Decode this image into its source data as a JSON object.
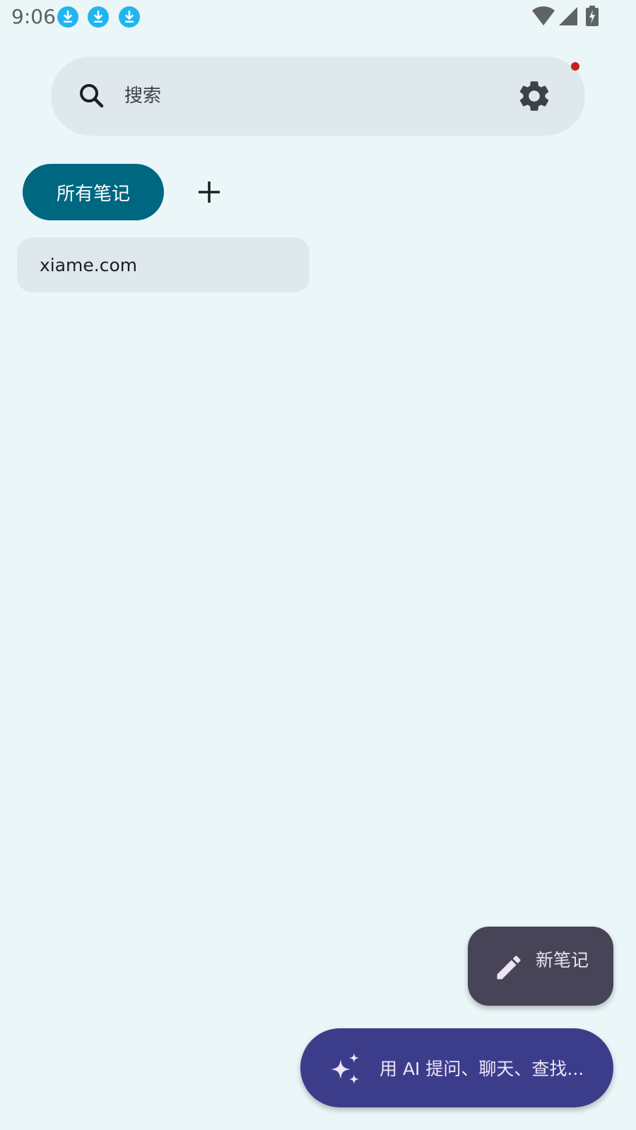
{
  "status_bar": {
    "time": "9:06",
    "notification_icons": [
      "download-icon",
      "download-icon",
      "download-icon"
    ],
    "system_icons": [
      "wifi-icon",
      "cell-signal-icon",
      "battery-charging-icon"
    ]
  },
  "search": {
    "placeholder": "搜索",
    "settings_icon": "gear-icon",
    "has_notification_dot": true
  },
  "tabs": {
    "items": [
      {
        "label": "所有笔记",
        "selected": true
      }
    ],
    "add_icon": "plus-icon"
  },
  "notes": [
    {
      "title": "xiame.com"
    }
  ],
  "fab_new": {
    "label": "新笔记",
    "icon": "pencil-icon"
  },
  "fab_ai": {
    "label": "用 AI 提问、聊天、查找...",
    "icon": "sparkle-icon"
  },
  "colors": {
    "background": "#EBF6F8",
    "surface": "#DFE8EC",
    "primary_tab": "#006780",
    "fab_new": "#474457",
    "fab_ai": "#3C3D8A",
    "status_download": "#1FB6F0",
    "notification_dot": "#C5221F"
  }
}
